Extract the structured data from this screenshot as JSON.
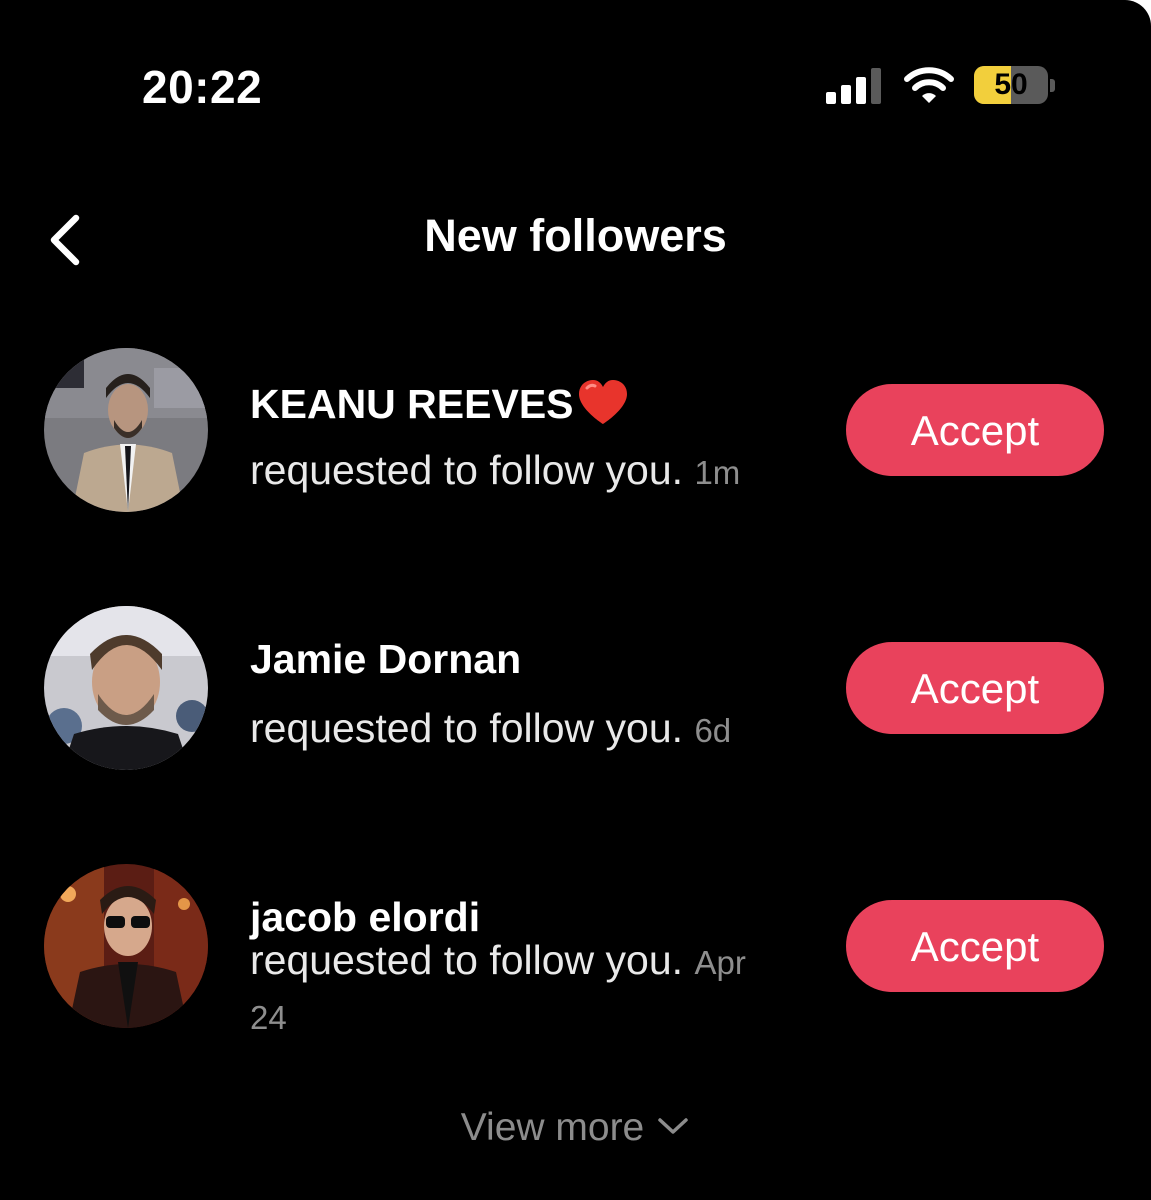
{
  "status_bar": {
    "time": "20:22",
    "battery_percent": 50,
    "battery_label": "50",
    "signal_bars_active": 3,
    "signal_bars_total": 4,
    "battery_color": "#f2cf3c"
  },
  "header": {
    "title": "New followers",
    "back_icon": "chevron-left-icon"
  },
  "requests": [
    {
      "name": "KEANU REEVES",
      "name_emoji": "heart-icon",
      "message": "requested to follow you.",
      "time": "1m",
      "accept_label": "Accept"
    },
    {
      "name": "Jamie Dornan",
      "message": "requested to follow you.",
      "time": "6d",
      "accept_label": "Accept"
    },
    {
      "name": "jacob elordi",
      "message": "requested to follow you.",
      "time": "Apr 24",
      "accept_label": "Accept"
    }
  ],
  "footer": {
    "view_more_label": "View more",
    "view_more_icon": "chevron-down-icon"
  },
  "colors": {
    "background": "#000000",
    "accept_button": "#e9425c",
    "secondary_text": "#8e8e8e"
  }
}
